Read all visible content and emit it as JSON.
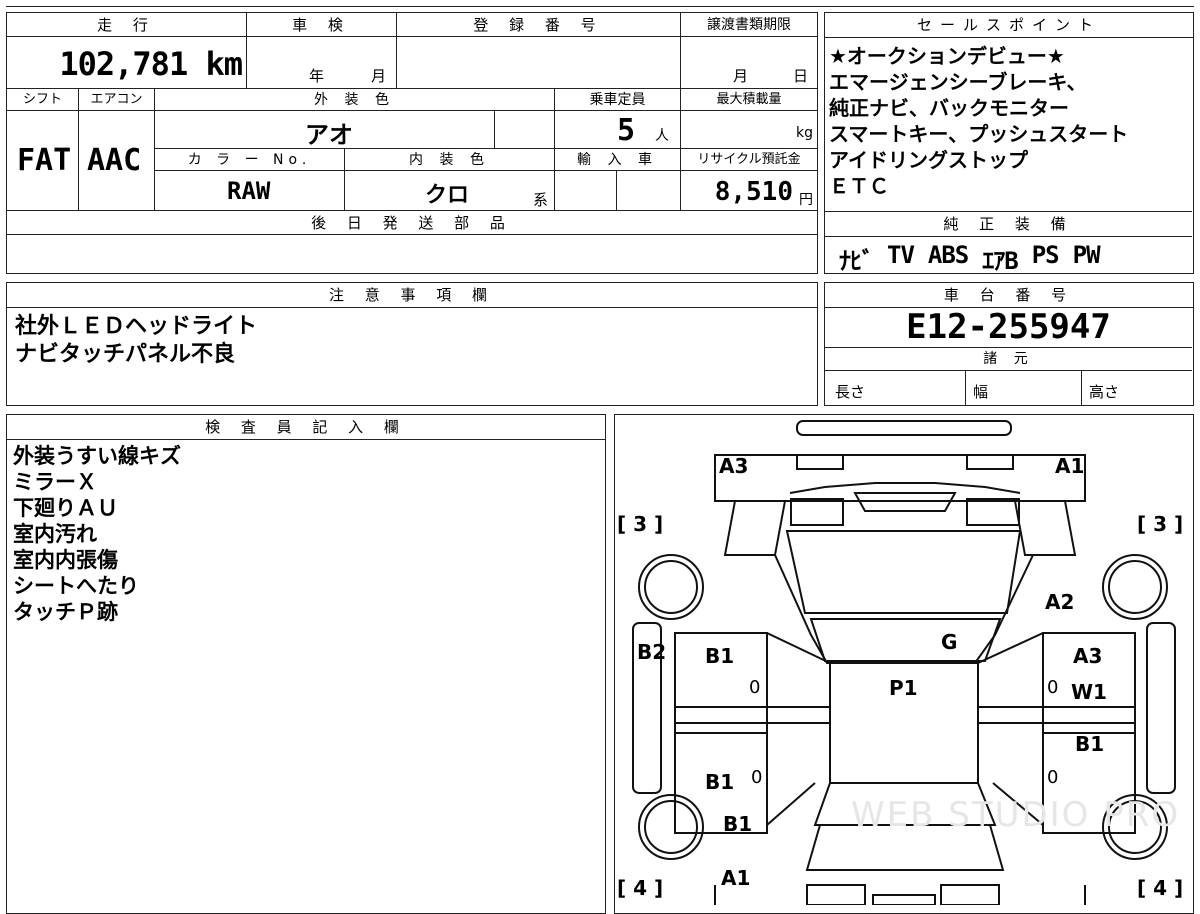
{
  "header": {
    "mileage_label": "走 行",
    "shaken_label": "車 検",
    "reg_label": "登 録 番 号",
    "transfer_label": "譲渡書類期限",
    "sales_label": "セールスポイント"
  },
  "values": {
    "mileage": "102,781 km",
    "shaken_year": "年",
    "shaken_month": "月",
    "transfer_month": "月",
    "transfer_day": "日",
    "shift_label": "シフト",
    "ac_label": "エアコン",
    "exterior_label": "外 装 色",
    "capacity_label": "乗車定員",
    "maxload_label": "最大積載量",
    "shift": "FAT",
    "ac": "AAC",
    "exterior_color": "アオ",
    "capacity": "5",
    "capacity_unit": "人",
    "maxload_unit": "kg",
    "color_no_label": "カ ラ ー No.",
    "interior_label": "内 装 色",
    "import_label": "輸 入 車",
    "recycle_label": "リサイクル預託金",
    "color_no": "RAW",
    "interior_color": "クロ",
    "interior_suffix": "系",
    "recycle_fee": "8,510",
    "recycle_unit": "円",
    "later_parts_label": "後 日 発 送 部 品"
  },
  "sales_points": [
    "★オークションデビュー★",
    "エマージェンシーブレーキ、",
    "純正ナビ、バックモニター",
    "スマートキー、プッシュスタート",
    "アイドリングストップ",
    "ＥＴＣ"
  ],
  "equipment": {
    "label": "純 正 装 備",
    "items": [
      "ﾅﾋﾞ",
      "TV",
      "ABS",
      "ｴｱB",
      "PS",
      "PW"
    ]
  },
  "notes": {
    "label": "注 意 事 項 欄",
    "lines": [
      "社外ＬＥＤヘッドライト",
      "ナビタッチパネル不良"
    ]
  },
  "chassis": {
    "label": "車 台 番 号",
    "number": "E12-255947",
    "spec_label": "諸 元",
    "length_label": "長さ",
    "width_label": "幅",
    "height_label": "高さ"
  },
  "inspector": {
    "label": "検 査 員 記 入 欄",
    "lines": [
      "外装うすい線キズ",
      "ミラーＸ",
      "下廻りＡＵ",
      "室内汚れ",
      "室内内張傷",
      "シートへたり",
      "タッチＰ跡"
    ]
  },
  "diagram": {
    "marks": {
      "a3_top": "A3",
      "a1_top": "A1",
      "a2": "A2",
      "b2": "B2",
      "b1_left_front": "B1",
      "g": "G",
      "a3_right": "A3",
      "p1": "P1",
      "w1": "W1",
      "b1_right": "B1",
      "b1_left_rear": "B1",
      "b1_rear": "B1",
      "a1_rear": "A1",
      "tire_fl": "[ 3 ]",
      "tire_fr": "[ 3 ]",
      "tire_rl": "[ 4 ]",
      "tire_rr": "[ 4 ]",
      "zero1": "0",
      "zero2": "0",
      "zero3": "0",
      "zero4": "0"
    },
    "watermark": "WEB STUDIO PRO"
  }
}
